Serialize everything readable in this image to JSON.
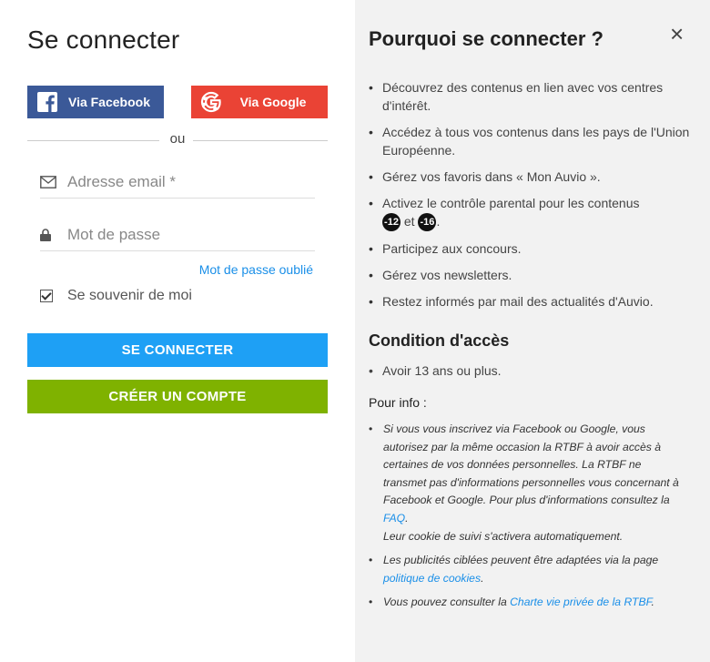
{
  "login": {
    "title": "Se connecter",
    "facebook_label": "Via Facebook",
    "google_label": "Via Google",
    "or_label": "ou",
    "email_placeholder": "Adresse email *",
    "password_placeholder": "Mot de passe",
    "forgot_label": "Mot de passe oublié",
    "remember_label": "Se souvenir de moi",
    "remember_checked": true,
    "submit_label": "SE CONNECTER",
    "create_label": "CRÉER UN COMPTE"
  },
  "why": {
    "title": "Pourquoi se connecter ?",
    "close_label": "×",
    "items": [
      "Découvrez des contenus en lien avec vos centres d'intérêt.",
      "Accédez à tous vos contenus dans les pays de l'Union Européenne.",
      "Gérez vos favoris dans « Mon Auvio ».",
      "Participez aux concours.",
      "Gérez vos newsletters.",
      "Restez informés par mail des actualités d'Auvio."
    ],
    "parental": {
      "text": "Activez le contrôle parental pour les contenus",
      "badge1": "-12",
      "and": "et",
      "badge2": "-16",
      "end": "."
    }
  },
  "access": {
    "title": "Condition d'accès",
    "age": "Avoir 13 ans ou plus."
  },
  "info": {
    "title": "Pour info :",
    "p1": "Si vous vous inscrivez via Facebook ou Google, vous autorisez par la même occasion la RTBF à avoir accès à certaines de vos données personnelles. La RTBF ne transmet pas d'informations personnelles vous concernant à Facebook et Google. Pour plus d'informations consultez la",
    "faq": "FAQ",
    "dot": ".",
    "cookie_text": "Leur cookie de suivi s'activera automatiquement.",
    "p2": "Les publicités ciblées peuvent être adaptées via la page",
    "cookies_link": "politique de cookies",
    "p3": "Vous pouvez consulter la",
    "privacy_link": "Charte vie privée de la RTBF"
  },
  "colors": {
    "facebook": "#3b5998",
    "google": "#ea4335",
    "login": "#1ea0f5",
    "create": "#7fb200",
    "link": "#1a8fe8",
    "panel": "#f2f2f2"
  }
}
